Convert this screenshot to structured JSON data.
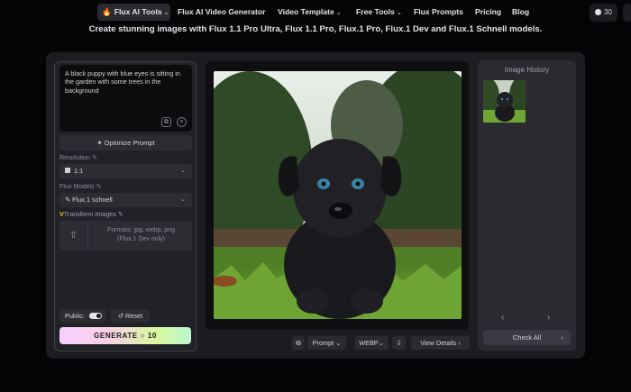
{
  "nav": {
    "brand": "Flux AI Tools",
    "items": [
      "Flux AI Video Generator",
      "Video Template",
      "Free Tools",
      "Flux Prompts",
      "Pricing",
      "Blog"
    ],
    "credits": "30"
  },
  "subtitle": "Create stunning images with Flux 1.1 Pro Ultra, Flux 1.1 Pro, Flux.1 Pro, Flux.1 Dev and Flux.1 Schnell models.",
  "left": {
    "prompt": "A black puppy with blue eyes is sitting in the garden with some trees in the background",
    "optimize_label": "Optimize Prompt",
    "resolution_label": "Resolution",
    "resolution_value": "1:1",
    "models_label": "Flux Models",
    "model_value": "Flux.1 schnell",
    "transform_label": "Transform Images",
    "transform_v": "V",
    "formats_line1": "Formats: jpg, webp, png",
    "formats_line2": "(Flux.1 Dev only)",
    "public_label": "Public:",
    "reset_label": "Reset",
    "generate_label": "GENERATE",
    "generate_cost": "10"
  },
  "toolbar": {
    "prompt_label": "Prompt",
    "format_label": "WEBP",
    "details_label": "View Details"
  },
  "history": {
    "title": "Image History",
    "check_all": "Check All"
  },
  "colors": {
    "background": "#050507",
    "card": "#1c1c21",
    "panel": "#212128",
    "accent_yellow": "#facc15",
    "brand_flame": "#f97316"
  },
  "icons": [
    "flame-icon",
    "chevron-down-icon",
    "copy-icon",
    "clear-icon",
    "magic-icon",
    "pencil-icon",
    "square-icon",
    "upload-icon",
    "eraser-icon",
    "download-icon",
    "chevron-left-icon",
    "chevron-right-icon"
  ]
}
